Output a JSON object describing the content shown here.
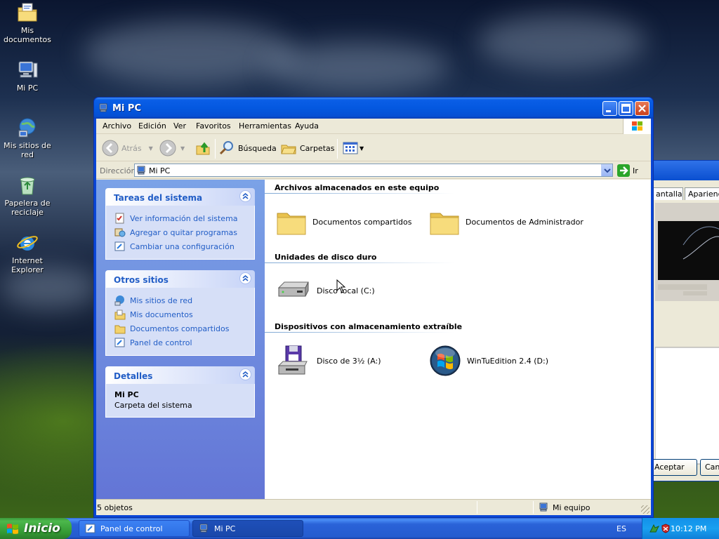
{
  "desktop": {
    "icons": [
      {
        "label": "Mis\ndocumentos",
        "icon": "my-documents-icon"
      },
      {
        "label": "Mi PC",
        "icon": "my-computer-icon"
      },
      {
        "label": "Mis sitios de\nred",
        "icon": "network-places-icon"
      },
      {
        "label": "Papelera de\nreciclaje",
        "icon": "recycle-bin-icon"
      },
      {
        "label": "Internet\nExplorer",
        "icon": "internet-explorer-icon"
      }
    ]
  },
  "background_dialog": {
    "tabs": [
      "antalla",
      "Aparienci"
    ],
    "ok_button": "Aceptar",
    "cancel_button": "Can"
  },
  "window": {
    "title": "Mi PC",
    "menu": [
      "Archivo",
      "Edición",
      "Ver",
      "Favoritos",
      "Herramientas",
      "Ayuda"
    ],
    "toolbar": {
      "back": "Atrás",
      "search": "Búsqueda",
      "folders": "Carpetas"
    },
    "address": {
      "label": "Dirección",
      "value": "Mi PC",
      "go": "Ir"
    },
    "side": {
      "system_tasks": {
        "title": "Tareas del sistema",
        "links": [
          "Ver información del sistema",
          "Agregar o quitar programas",
          "Cambiar una configuración"
        ]
      },
      "other_places": {
        "title": "Otros sitios",
        "links": [
          "Mis sitios de red",
          "Mis documentos",
          "Documentos compartidos",
          "Panel de control"
        ]
      },
      "details": {
        "title": "Detalles",
        "name": "Mi PC",
        "type": "Carpeta del sistema"
      }
    },
    "content": {
      "groups": {
        "stored_files": "Archivos almacenados en este equipo",
        "hard_drives": "Unidades de disco duro",
        "removable": "Dispositivos con almacenamiento extraíble"
      },
      "items": {
        "shared_docs": "Documentos compartidos",
        "admin_docs": "Documentos de Administrador",
        "local_disk": "Disco local (C:)",
        "floppy": "Disco de 3½ (A:)",
        "cd_drive": "WinTuEdition 2.4 (D:)"
      }
    },
    "status": {
      "count": "5 objetos",
      "zone": "Mi equipo"
    }
  },
  "taskbar": {
    "start": "Inicio",
    "tasks": [
      "Panel de control",
      "Mi PC"
    ],
    "language": "ES",
    "clock": "10:12 PM"
  },
  "colors": {
    "xp_blue": "#0a46d6",
    "link_blue": "#215dc6",
    "start_green": "#3c9a3c",
    "tray_blue": "#1290e9"
  }
}
